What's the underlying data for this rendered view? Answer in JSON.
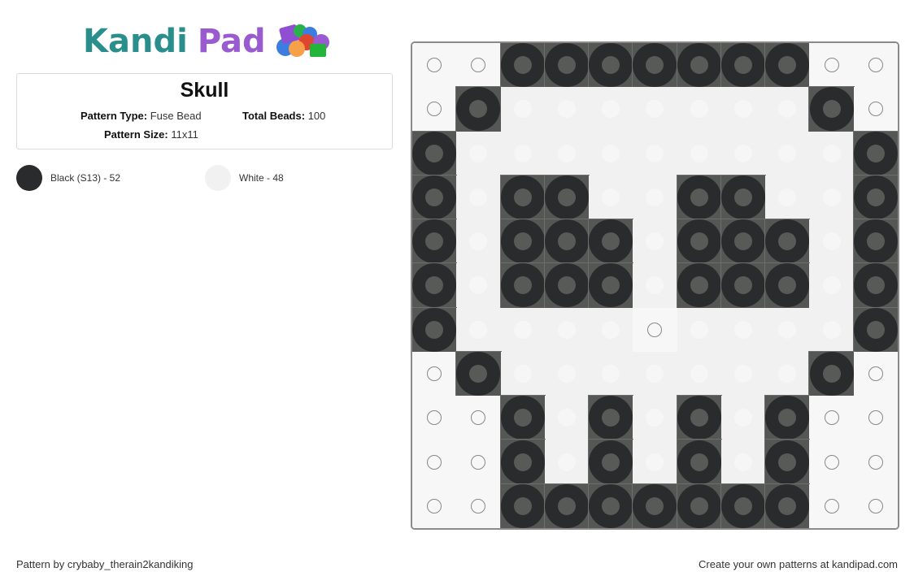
{
  "logo": {
    "part1": "Kandi",
    "part2": "Pad"
  },
  "pattern": {
    "title": "Skull",
    "type_label": "Pattern Type:",
    "type_value": "Fuse Bead",
    "total_label": "Total Beads:",
    "total_value": "100",
    "size_label": "Pattern Size:",
    "size_value": "11x11"
  },
  "legend": [
    {
      "name": "Black (S13) - 52",
      "color": "#2a2b2d"
    },
    {
      "name": "White - 48",
      "color": "#f1f1f1"
    }
  ],
  "grid": {
    "rows": [
      "..KKKKKKK..",
      ".KWWWWWWWK.",
      "KWWWWWWWWWK",
      "KWKKWWKKWWK",
      "KWKKKWKKKWK",
      "KWKKKWKKKWK",
      "KWWWW.WWWWK",
      ".KWWWWWWWK.",
      "..KWKWKWK..",
      "..KWKWKWK..",
      "..KKKKKKK.."
    ],
    "key": {
      "K": "Black (S13)",
      "W": "White",
      ".": "empty"
    }
  },
  "footer": {
    "credit": "Pattern by crybaby_therain2kandiking",
    "promo": "Create your own patterns at kandipad.com"
  }
}
